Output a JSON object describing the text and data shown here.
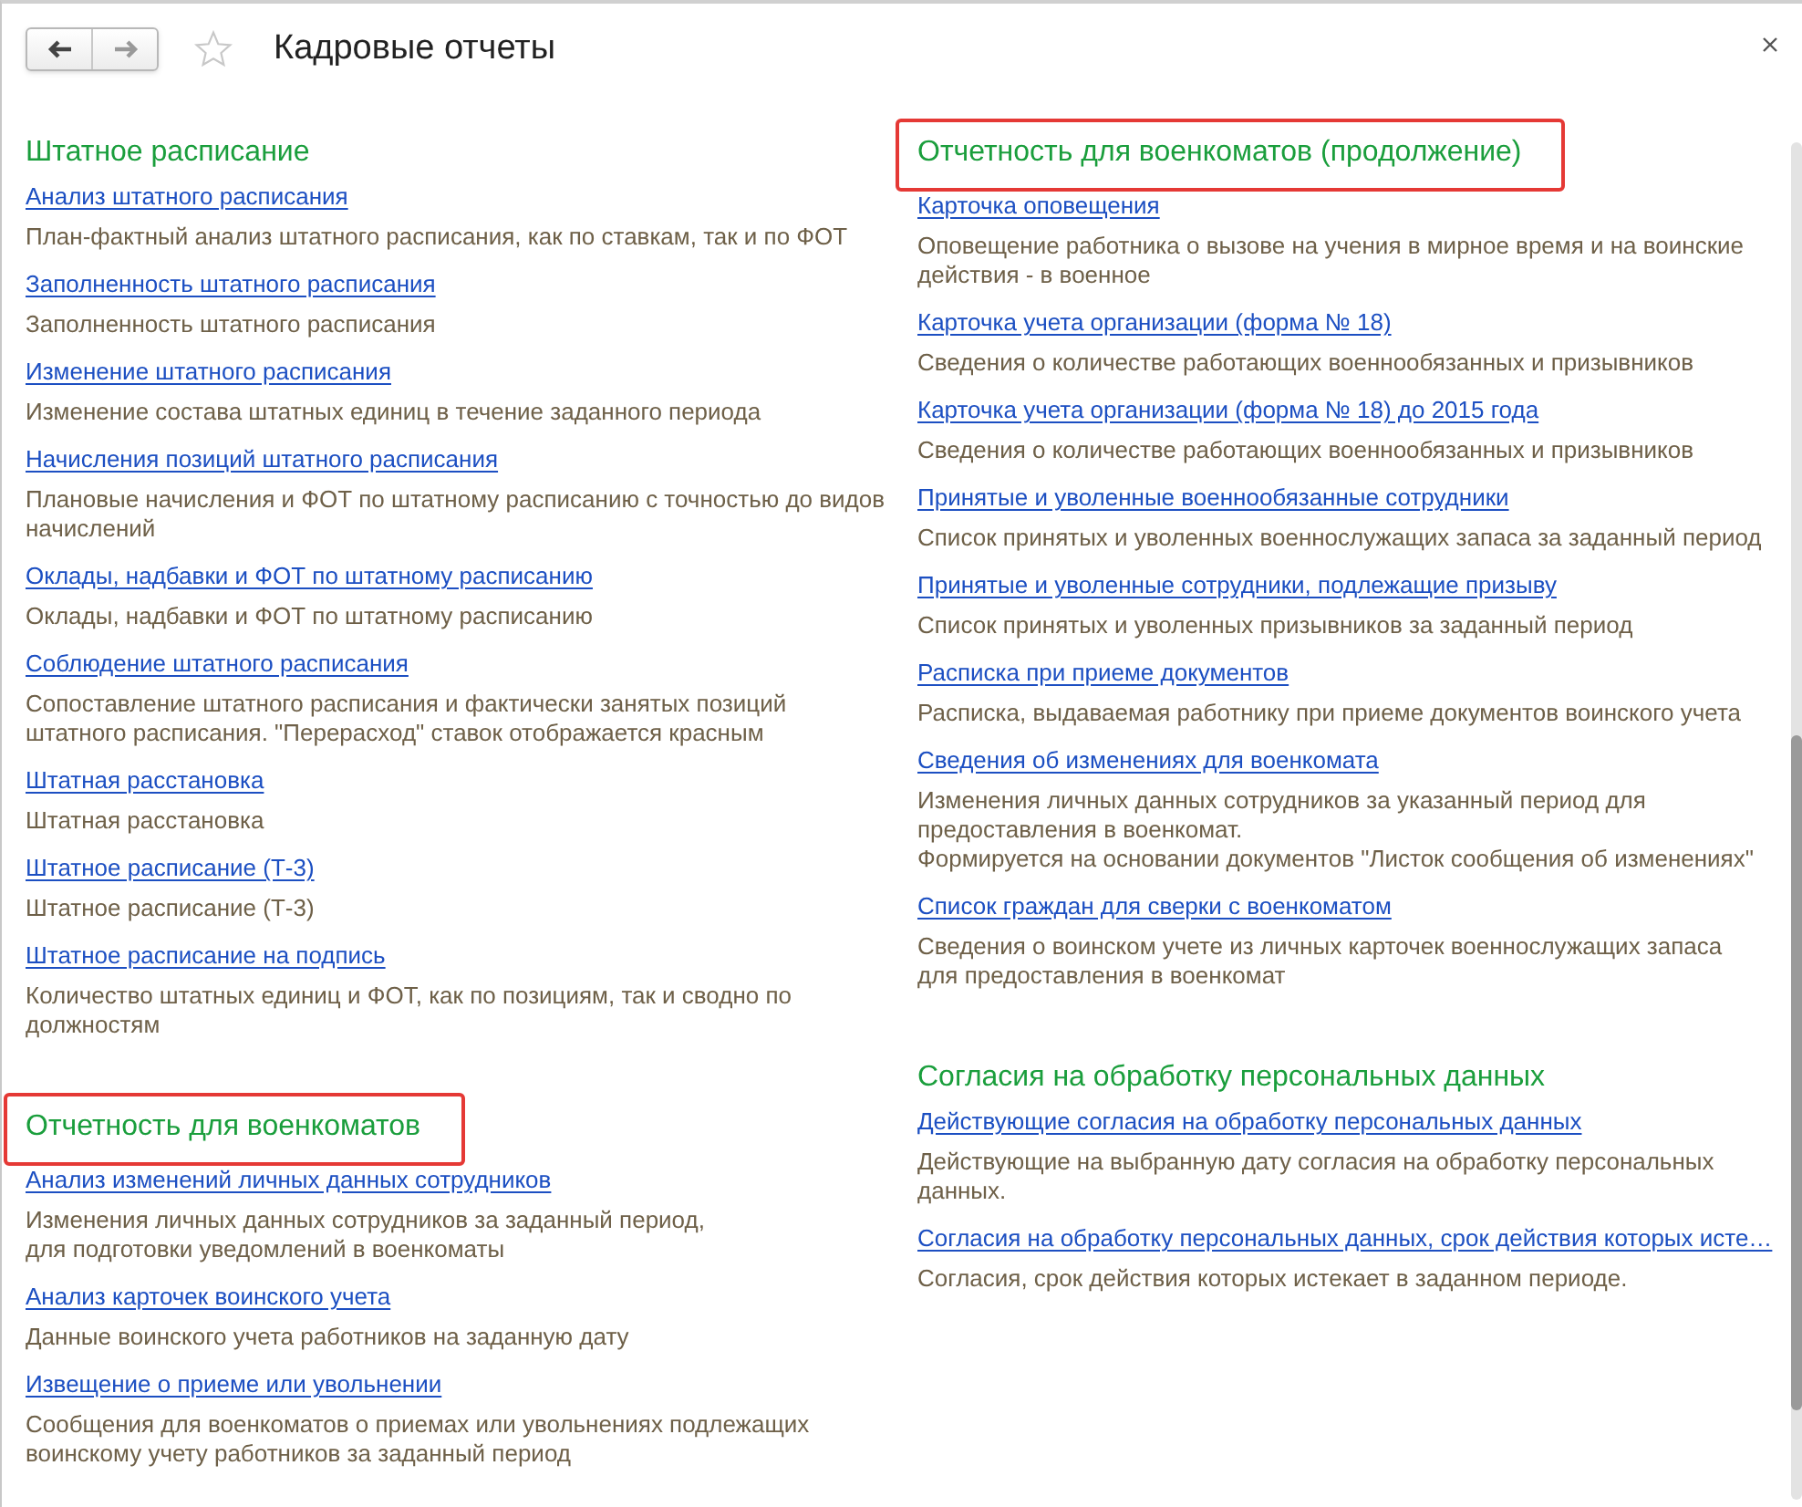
{
  "window": {
    "title": "Кадровые отчеты",
    "favorite": false
  },
  "columns": [
    {
      "sections": [
        {
          "title": "Штатное расписание",
          "highlighted": false,
          "items": [
            {
              "link": "Анализ штатного расписания",
              "description": "План-фактный анализ штатного расписания, как по ставкам, так и по ФОТ"
            },
            {
              "link": "Заполненность штатного расписания",
              "description": "Заполненность штатного расписания"
            },
            {
              "link": "Изменение штатного расписания",
              "description": "Изменение состава штатных единиц в течение заданного периода"
            },
            {
              "link": "Начисления позиций штатного расписания",
              "description": "Плановые начисления и ФОТ по штатному расписанию с точностью до видов\nначислений"
            },
            {
              "link": "Оклады, надбавки и ФОТ по штатному расписанию",
              "description": "Оклады, надбавки и ФОТ по штатному расписанию"
            },
            {
              "link": "Соблюдение штатного расписания",
              "description": "Сопоставление штатного расписания и фактически занятых позиций\nштатного расписания. \"Перерасход\" ставок отображается красным"
            },
            {
              "link": "Штатная расстановка",
              "description": "Штатная расстановка"
            },
            {
              "link": "Штатное расписание (Т-3)",
              "description": "Штатное расписание (Т-3)"
            },
            {
              "link": "Штатное расписание на подпись",
              "description": "Количество штатных единиц и ФОТ, как по позициям, так и сводно по\nдолжностям"
            }
          ]
        },
        {
          "title": "Отчетность для военкоматов",
          "highlighted": true,
          "items": [
            {
              "link": "Анализ изменений личных данных сотрудников",
              "description": "Изменения личных данных сотрудников за заданный период,\nдля подготовки уведомлений в военкоматы"
            },
            {
              "link": "Анализ карточек воинского учета",
              "description": "Данные воинского учета работников на заданную дату"
            },
            {
              "link": "Извещение о приеме или увольнении",
              "description": "Сообщения для военкоматов о приемах или увольнениях подлежащих\nвоинскому учету работников за заданный период"
            }
          ]
        }
      ]
    },
    {
      "sections": [
        {
          "title": "Отчетность для военкоматов (продолжение)",
          "highlighted": true,
          "items": [
            {
              "link": "Карточка оповещения",
              "description": "Оповещение работника о вызове на учения в мирное время и на воинские\nдействия - в военное"
            },
            {
              "link": "Карточка учета организации (форма № 18)",
              "description": "Сведения о количестве работающих военнообязанных и призывников"
            },
            {
              "link": "Карточка учета организации (форма № 18) до 2015 года",
              "description": "Сведения о количестве работающих военнообязанных и призывников"
            },
            {
              "link": "Принятые и уволенные военнообязанные сотрудники",
              "description": "Список принятых и уволенных военнослужащих запаса за заданный период"
            },
            {
              "link": "Принятые и уволенные сотрудники, подлежащие призыву",
              "description": "Список принятых и уволенных призывников за заданный период"
            },
            {
              "link": "Расписка при приеме документов",
              "description": "Расписка, выдаваемая работнику при приеме документов воинского учета"
            },
            {
              "link": "Сведения об изменениях для военкомата",
              "description": "Изменения личных данных сотрудников за указанный период для\nпредоставления в военкомат.\nФормируется на основании документов \"Листок сообщения об изменениях\""
            },
            {
              "link": "Список граждан для сверки с военкоматом",
              "description": "Сведения о воинском учете из личных карточек военнослужащих запаса\nдля предоставления в военкомат"
            }
          ]
        },
        {
          "title": "Согласия на обработку персональных данных",
          "highlighted": false,
          "items": [
            {
              "link": "Действующие согласия на обработку персональных данных",
              "description": "Действующие на выбранную дату согласия на обработку персональных\nданных."
            },
            {
              "link": "Согласия на обработку персональных данных, срок действия которых исте…",
              "description": "Согласия, срок действия которых истекает в заданном периоде."
            }
          ]
        }
      ]
    }
  ]
}
